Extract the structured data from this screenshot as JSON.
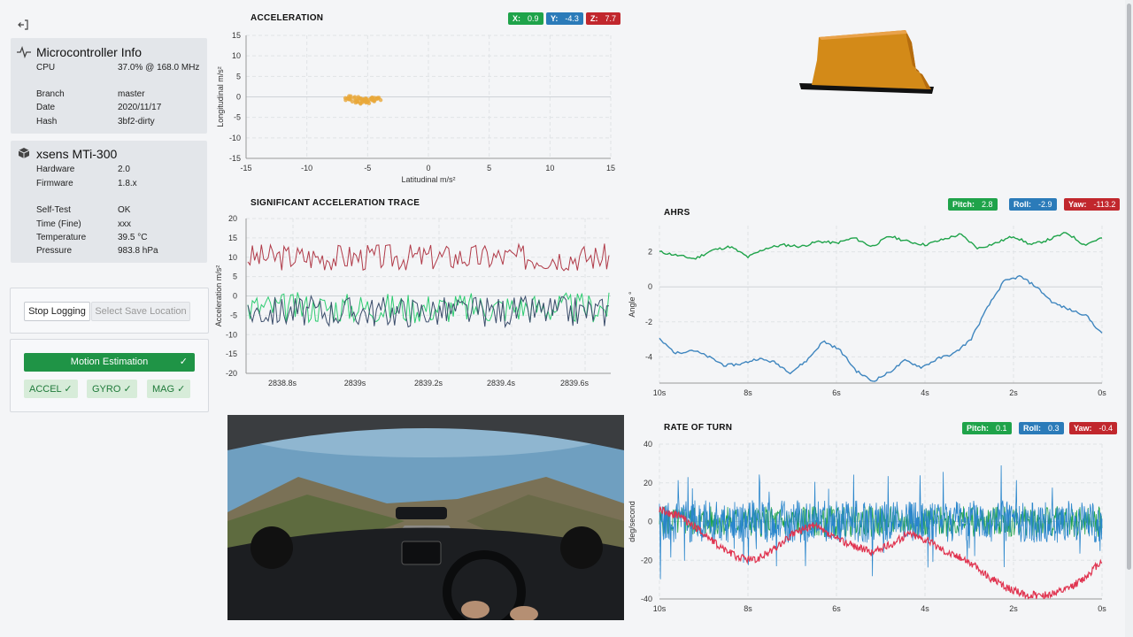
{
  "sidebar": {
    "mcu": {
      "title": "Microcontroller Info",
      "rows": [
        {
          "k": "CPU",
          "v": "37.0% @ 168.0 MHz"
        },
        {
          "k": "Branch",
          "v": "master"
        },
        {
          "k": "Date",
          "v": "2020/11/17"
        },
        {
          "k": "Hash",
          "v": "3bf2-dirty"
        }
      ]
    },
    "imu": {
      "title": "xsens MTi-300",
      "rows": [
        {
          "k": "Hardware",
          "v": "2.0"
        },
        {
          "k": "Firmware",
          "v": "1.8.x"
        },
        {
          "k": "Self-Test",
          "v": "OK"
        },
        {
          "k": "Time (Fine)",
          "v": "xxx"
        },
        {
          "k": "Temperature",
          "v": "39.5 °C"
        },
        {
          "k": "Pressure",
          "v": "983.8 hPa"
        }
      ]
    },
    "logging": {
      "stop": "Stop Logging",
      "select": "Select Save Location"
    },
    "motion": {
      "label": "Motion Estimation",
      "accel": "ACCEL",
      "gyro": "GYRO",
      "mag": "MAG"
    }
  },
  "accel": {
    "title": "ACCELERATION",
    "badges": {
      "x_label": "X:",
      "x": "0.9",
      "y_label": "Y:",
      "y": "-4.3",
      "z_label": "Z:",
      "z": "7.7"
    }
  },
  "sig": {
    "title": "SIGNIFICANT ACCELERATION TRACE"
  },
  "ahrs": {
    "title": "AHRS",
    "badges": {
      "p_label": "Pitch:",
      "p": "2.8",
      "r_label": "Roll:",
      "r": "-2.9",
      "y_label": "Yaw:",
      "y": "-113.2"
    }
  },
  "rot": {
    "title": "RATE OF TURN",
    "badges": {
      "p_label": "Pitch:",
      "p": "0.1",
      "r_label": "Roll:",
      "r": "0.3",
      "y_label": "Yaw:",
      "y": "-0.4"
    }
  },
  "colors": {
    "green": "#1fa34a",
    "blue": "#2b7bb9",
    "red": "#c1272d",
    "orange": "#e8a73a"
  },
  "chart_data": [
    {
      "type": "scatter",
      "title": "ACCELERATION",
      "xlabel": "Latitudinal m/s²",
      "ylabel": "Longitudinal m/s²",
      "xlim": [
        -15,
        15
      ],
      "ylim": [
        -15,
        15
      ],
      "xticks": [
        "-15",
        "-10",
        "-5",
        "0",
        "5",
        "10",
        "15"
      ],
      "yticks": [
        "15",
        "10",
        "5",
        "0",
        "-5",
        "-10",
        "-15"
      ],
      "series": [
        {
          "values_xy": [
            [
              -6.5,
              -0.6
            ],
            [
              -6,
              -0.8
            ],
            [
              -5.5,
              -0.4
            ],
            [
              -5,
              -1
            ],
            [
              -4.8,
              -0.3
            ],
            [
              -5.8,
              -1.2
            ],
            [
              -4.5,
              -0.7
            ],
            [
              -6.2,
              -0.2
            ],
            [
              -5.2,
              -1.4
            ],
            [
              -4.2,
              -0.5
            ]
          ]
        }
      ]
    },
    {
      "type": "line",
      "title": "SIGNIFICANT ACCELERATION TRACE",
      "ylabel": "Acceleration m/s²",
      "ylim": [
        -20,
        20
      ],
      "yticks": [
        "20",
        "15",
        "10",
        "5",
        "0",
        "-5",
        "-10",
        "-15",
        "-20"
      ],
      "xticks": [
        "2838.8s",
        "2839s",
        "2839.2s",
        "2839.4s",
        "2839.6s"
      ],
      "series": [
        {
          "mean": 10
        },
        {
          "mean": -3
        },
        {
          "mean": -4
        }
      ]
    },
    {
      "type": "line",
      "title": "AHRS",
      "ylabel": "Angle °",
      "ylim": [
        -5.5,
        3.5
      ],
      "yticks": [
        "2",
        "0",
        "-2",
        "-4"
      ],
      "xticks": [
        "10s",
        "8s",
        "6s",
        "4s",
        "2s",
        "0s"
      ],
      "series": [
        {
          "values": [
            2,
            1.8,
            1.6,
            2.1,
            2.3,
            1.7,
            2.2,
            2.4,
            2.3,
            2.6,
            2.5,
            2.8,
            2.3,
            2.9,
            2.6,
            2.4,
            2.7,
            3.0,
            2.2,
            2.5,
            2.9,
            2.4,
            2.7,
            3.1,
            2.4,
            2.8
          ]
        },
        {
          "values": [
            -3,
            -3.8,
            -3.6,
            -4,
            -4.5,
            -4.4,
            -4.1,
            -4.3,
            -4.9,
            -4.2,
            -3.1,
            -3.6,
            -4.8,
            -5.4,
            -4.9,
            -4.2,
            -4.6,
            -4.1,
            -3.8,
            -3.0,
            -1.2,
            0.3,
            0.6,
            0,
            -0.9,
            -1.3,
            -1.6,
            -2.7
          ]
        }
      ]
    },
    {
      "type": "line",
      "title": "RATE OF TURN",
      "ylabel": "deg/second",
      "ylim": [
        -40,
        40
      ],
      "yticks": [
        "40",
        "20",
        "0",
        "-20",
        "-40"
      ],
      "xticks": [
        "10s",
        "8s",
        "6s",
        "4s",
        "2s",
        "0s"
      ],
      "series": [
        {
          "values": [
            6,
            3,
            -4,
            -12,
            -18,
            -20,
            -14,
            -6,
            -2,
            -8,
            -12,
            -16,
            -12,
            -6,
            -10,
            -16,
            -20,
            -28,
            -34,
            -38,
            -38,
            -36,
            -30,
            -20
          ]
        }
      ]
    }
  ]
}
